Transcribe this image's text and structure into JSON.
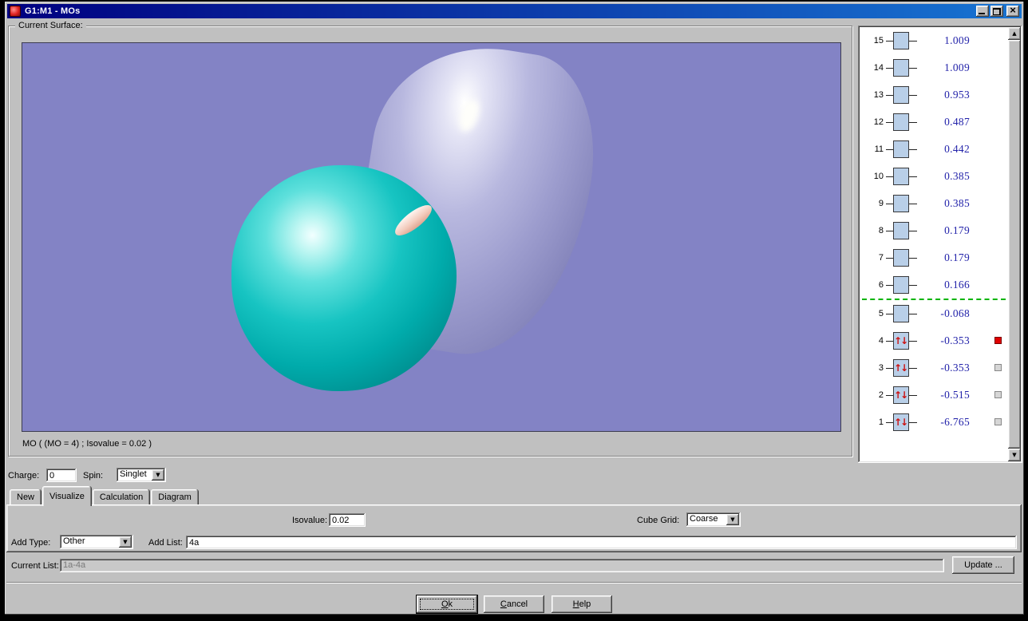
{
  "window": {
    "title": "G1:M1 - MOs"
  },
  "colors": {
    "titlebar_left": "#000080",
    "titlebar_right": "#1874d2",
    "window_gray": "#c0c0c0",
    "viewport_bg": "#8383c5",
    "lobe_teal": "#00b2b2",
    "lobe_lavender": "#9a9ad0",
    "atom_pink": "#f0c9ba",
    "energy_text": "#2323aa",
    "spin_arrow_red": "#cc1111",
    "divider_green": "#00b400",
    "marker_red": "#e00000"
  },
  "surface": {
    "group_label": "Current Surface:",
    "caption": "MO ( (MO = 4) ; Isovalue = 0.02 )"
  },
  "mo_list": {
    "spin_icon": "↑↓",
    "divider_after_num": "6",
    "rows": [
      {
        "num": "15",
        "energy": "1.009",
        "occupied": false,
        "marker": "none"
      },
      {
        "num": "14",
        "energy": "1.009",
        "occupied": false,
        "marker": "none"
      },
      {
        "num": "13",
        "energy": "0.953",
        "occupied": false,
        "marker": "none"
      },
      {
        "num": "12",
        "energy": "0.487",
        "occupied": false,
        "marker": "none"
      },
      {
        "num": "11",
        "energy": "0.442",
        "occupied": false,
        "marker": "none"
      },
      {
        "num": "10",
        "energy": "0.385",
        "occupied": false,
        "marker": "none"
      },
      {
        "num": "9",
        "energy": "0.385",
        "occupied": false,
        "marker": "none"
      },
      {
        "num": "8",
        "energy": "0.179",
        "occupied": false,
        "marker": "none"
      },
      {
        "num": "7",
        "energy": "0.179",
        "occupied": false,
        "marker": "none"
      },
      {
        "num": "6",
        "energy": "0.166",
        "occupied": false,
        "marker": "none"
      },
      {
        "num": "5",
        "energy": "-0.068",
        "occupied": false,
        "marker": "none"
      },
      {
        "num": "4",
        "energy": "-0.353",
        "occupied": true,
        "marker": "red"
      },
      {
        "num": "3",
        "energy": "-0.353",
        "occupied": true,
        "marker": "gray"
      },
      {
        "num": "2",
        "energy": "-0.515",
        "occupied": true,
        "marker": "gray"
      },
      {
        "num": "1",
        "energy": "-6.765",
        "occupied": true,
        "marker": "gray"
      }
    ]
  },
  "controls": {
    "charge_label": "Charge:",
    "charge_value": "0",
    "spin_label": "Spin:",
    "spin_value": "Singlet",
    "tabs": [
      {
        "label": "New",
        "active": false
      },
      {
        "label": "Visualize",
        "active": true
      },
      {
        "label": "Calculation",
        "active": false
      },
      {
        "label": "Diagram",
        "active": false
      }
    ],
    "isovalue_label": "Isovalue:",
    "isovalue_value": "0.02",
    "cube_grid_label": "Cube Grid:",
    "cube_grid_value": "Coarse",
    "add_type_label": "Add Type:",
    "add_type_value": "Other",
    "add_list_label": "Add List:",
    "add_list_value": "4a",
    "current_list_label": "Current List:",
    "current_list_value": "1a-4a",
    "update_button": "Update ...",
    "ok_button": "Ok",
    "cancel_button": "Cancel",
    "help_button": "Help"
  }
}
